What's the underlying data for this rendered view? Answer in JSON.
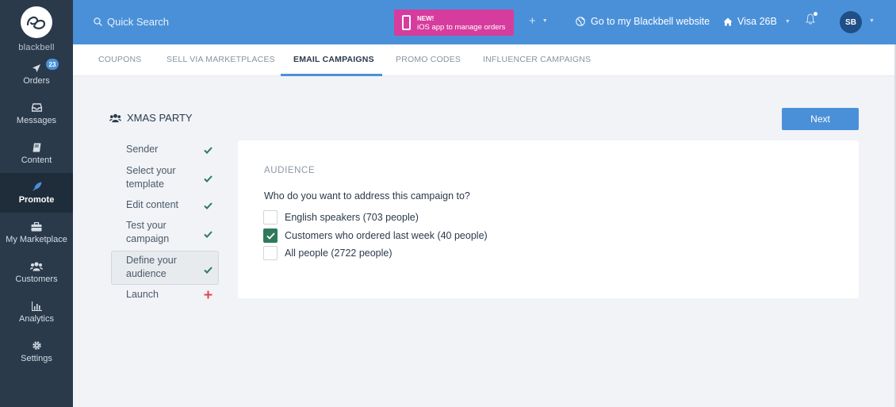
{
  "brand": {
    "name": "blackbell"
  },
  "sidebar": {
    "items": [
      {
        "key": "orders",
        "label": "Orders",
        "icon": "send-icon",
        "badge": "23"
      },
      {
        "key": "messages",
        "label": "Messages",
        "icon": "inbox-icon"
      },
      {
        "key": "content",
        "label": "Content",
        "icon": "book-icon"
      },
      {
        "key": "promote",
        "label": "Promote",
        "icon": "rocket-icon",
        "active": true
      },
      {
        "key": "marketplace",
        "label": "My Marketplace",
        "icon": "briefcase-icon"
      },
      {
        "key": "customers",
        "label": "Customers",
        "icon": "users-icon"
      },
      {
        "key": "analytics",
        "label": "Analytics",
        "icon": "bar-chart-icon"
      },
      {
        "key": "settings",
        "label": "Settings",
        "icon": "gear-icon"
      }
    ]
  },
  "topbar": {
    "search_placeholder": "Quick Search",
    "promo_new": "NEW!",
    "promo_text": "iOS app to manage orders",
    "goto_site": "Go to my Blackbell website",
    "store": "Visa 26B",
    "avatar_initials": "SB"
  },
  "tabs": [
    {
      "label": "COUPONS"
    },
    {
      "label": "SELL VIA MARKETPLACES"
    },
    {
      "label": "EMAIL CAMPAIGNS",
      "active": true
    },
    {
      "label": "PROMO CODES"
    },
    {
      "label": "INFLUENCER CAMPAIGNS"
    }
  ],
  "campaign": {
    "title": "XMAS PARTY",
    "next_label": "Next"
  },
  "steps": [
    {
      "label": "Sender",
      "status": "done"
    },
    {
      "label": "Select your template",
      "status": "done"
    },
    {
      "label": "Edit content",
      "status": "done"
    },
    {
      "label": "Test your campaign",
      "status": "done"
    },
    {
      "label": "Define your audience",
      "status": "done",
      "active": true
    },
    {
      "label": "Launch",
      "status": "missing"
    }
  ],
  "audience": {
    "section_title": "AUDIENCE",
    "question": "Who do you want to address this campaign to?",
    "options": [
      {
        "label": "English speakers (703 people)",
        "checked": false
      },
      {
        "label": "Customers who ordered last week (40 people)",
        "checked": true
      },
      {
        "label": "All people (2722 people)",
        "checked": false
      }
    ]
  },
  "colors": {
    "sidebar_bg": "#2b3a4b",
    "topbar_bg": "#4a90d9",
    "promo_bg": "#d63c9d",
    "check_green": "#2e7a5a",
    "missing_red": "#e04646"
  }
}
